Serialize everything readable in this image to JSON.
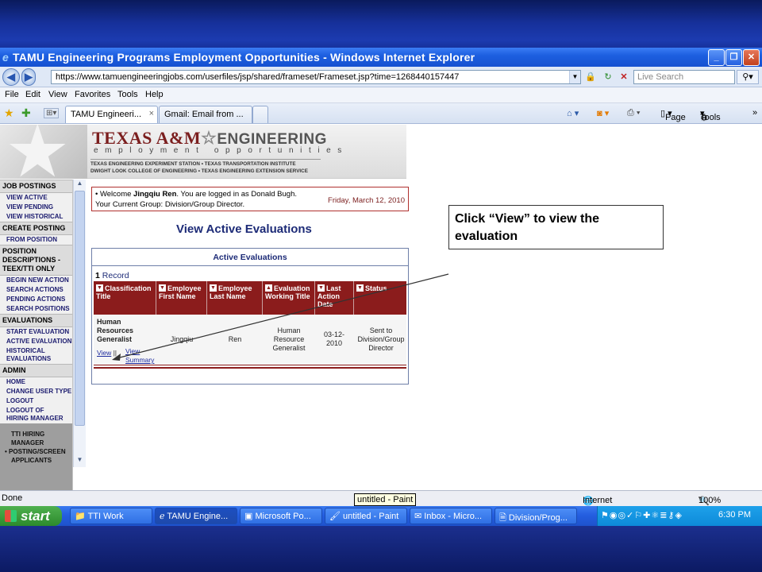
{
  "window": {
    "title": "TAMU Engineering Programs Employment Opportunities - Windows Internet Explorer",
    "url": "https://www.tamuengineeringjobs.com/userfiles/jsp/shared/frameset/Frameset.jsp?time=1268440157447",
    "search_placeholder": "Live Search",
    "menu": [
      "File",
      "Edit",
      "View",
      "Favorites",
      "Tools",
      "Help"
    ],
    "tabs": [
      {
        "label": "TAMU Engineeri...",
        "active": true
      },
      {
        "label": "Gmail: Email from ...",
        "active": false
      }
    ],
    "toolbar_right": {
      "page": "Page",
      "tools": "Tools"
    }
  },
  "banner": {
    "brand_main": "TEXAS A&M",
    "brand_eng": "ENGINEERING",
    "brand_sub": "employment opportunities",
    "line1": "TEXAS ENGINEERING EXPERIMENT STATION • TEXAS TRANSPORTATION INSTITUTE",
    "line2": "DWIGHT LOOK COLLEGE OF ENGINEERING • TEXAS ENGINEERING EXTENSION SERVICE"
  },
  "sidebar": {
    "sections": [
      {
        "head": "JOB POSTINGS",
        "items": [
          "VIEW ACTIVE",
          "VIEW PENDING",
          "VIEW HISTORICAL"
        ]
      },
      {
        "head": "CREATE POSTING",
        "items": [
          "FROM POSITION"
        ]
      },
      {
        "head": "POSITION DESCRIPTIONS - TEEX/TTI ONLY",
        "items": [
          "BEGIN NEW ACTION",
          "SEARCH ACTIONS",
          "PENDING ACTIONS",
          "SEARCH POSITIONS"
        ]
      },
      {
        "head": "EVALUATIONS",
        "items": [
          "START EVALUATION",
          "ACTIVE EVALUATIONS",
          "HISTORICAL EVALUATIONS"
        ]
      },
      {
        "head": "ADMIN",
        "items": [
          "HOME",
          "CHANGE USER TYPE",
          "LOGOUT",
          "LOGOUT OF HIRING MANAGER"
        ]
      }
    ],
    "gray_lines": [
      "TTI HIRING",
      "MANAGER",
      "• POSTING/SCREEN",
      "APPLICANTS"
    ]
  },
  "welcome": {
    "prefix": "• Welcome",
    "name": "Jingqiu Ren",
    "rest": ". You are logged in as Donald Bugh.",
    "group": "Your Current Group: Division/Group Director.",
    "date": "Friday, March 12, 2010"
  },
  "page_title": "View Active Evaluations",
  "panel": {
    "title": "Active Evaluations",
    "record_count": "1",
    "record_label": "Record",
    "columns": [
      {
        "label": "Classification Title",
        "sort": "down"
      },
      {
        "label": "Employee First Name",
        "sort": "down"
      },
      {
        "label": "Employee Last Name",
        "sort": "down"
      },
      {
        "label": "Evaluation Working Title",
        "sort": "up"
      },
      {
        "label": "Last Action Date",
        "sort": "down"
      },
      {
        "label": "Status",
        "sort": "down"
      }
    ],
    "row": {
      "classification": "Human Resources Generalist",
      "link_view": "View",
      "link_view_summary": "View Summary",
      "first_name": "Jingqiu",
      "last_name": "Ren",
      "working_title": "Human Resource Generalist",
      "date": "03-12-2010",
      "status": "Sent to Division/Group Director"
    }
  },
  "callout": "Click “View” to view the evaluation",
  "status": {
    "left": "Done",
    "zone": "Internet",
    "zoom": "100%",
    "tooltip": "untitled - Paint"
  },
  "taskbar": {
    "start": "start",
    "items": [
      {
        "label": "TTI Work",
        "icon": "folder-icon"
      },
      {
        "label": "TAMU Engine...",
        "icon": "ie-icon"
      },
      {
        "label": "Microsoft Po...",
        "icon": "powerpoint-icon"
      },
      {
        "label": "untitled - Paint",
        "icon": "paint-icon"
      },
      {
        "label": "Inbox - Micro...",
        "icon": "outlook-icon"
      },
      {
        "label": "Division/Prog...",
        "icon": "document-icon"
      }
    ],
    "clock": "6:30 PM"
  }
}
